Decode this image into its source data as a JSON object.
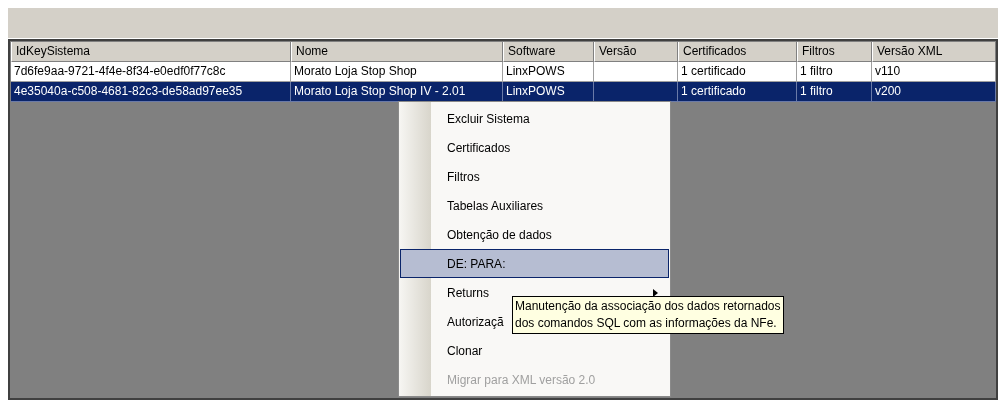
{
  "table": {
    "columns": [
      "IdKeySistema",
      "Nome",
      "Software",
      "Versão",
      "Certificados",
      "Filtros",
      "Versão XML"
    ],
    "rows": [
      {
        "selected": false,
        "cells": [
          "7d6fe9aa-9721-4f4e-8f34-e0edf0f77c8c",
          "Morato Loja Stop Shop",
          "LinxPOWS",
          "",
          "1 certificado",
          "1 filtro",
          "v110"
        ]
      },
      {
        "selected": true,
        "cells": [
          "4e35040a-c508-4681-82c3-de58ad97ee35",
          "Morato Loja Stop Shop IV - 2.01",
          "LinxPOWS",
          "",
          "1 certificado",
          "1 filtro",
          "v200"
        ]
      }
    ]
  },
  "context_menu": {
    "items": [
      {
        "label": "Excluir Sistema",
        "selected": false,
        "disabled": false,
        "submenu": false
      },
      {
        "label": "Certificados",
        "selected": false,
        "disabled": false,
        "submenu": false
      },
      {
        "label": "Filtros",
        "selected": false,
        "disabled": false,
        "submenu": false
      },
      {
        "label": "Tabelas Auxiliares",
        "selected": false,
        "disabled": false,
        "submenu": false
      },
      {
        "label": "Obtenção de dados",
        "selected": false,
        "disabled": false,
        "submenu": false
      },
      {
        "label": "DE: PARA:",
        "selected": true,
        "disabled": false,
        "submenu": false
      },
      {
        "label": "Returns",
        "selected": false,
        "disabled": false,
        "submenu": true
      },
      {
        "label": "Autorizaçã",
        "selected": false,
        "disabled": false,
        "submenu": false
      },
      {
        "label": "Clonar",
        "selected": false,
        "disabled": false,
        "submenu": false
      },
      {
        "label": "Migrar para XML versão 2.0",
        "selected": false,
        "disabled": true,
        "submenu": false
      }
    ]
  },
  "tooltip": {
    "lines": [
      "Manutenção da associação dos dados retornados",
      "dos comandos SQL com as informações da NFe."
    ]
  }
}
